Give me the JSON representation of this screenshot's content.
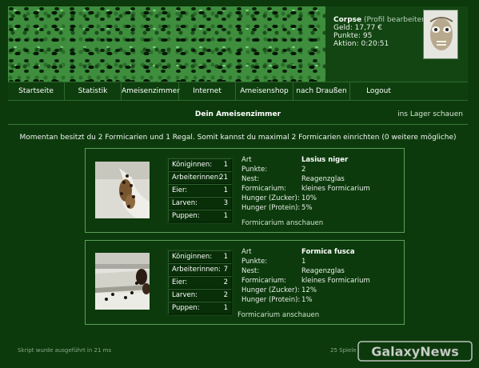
{
  "user": {
    "name": "Corpse",
    "profile_link": "(Profil bearbeiten)",
    "geld": "Geld: 17,77 €",
    "punkte": "Punkte: 95",
    "aktion": "Aktion: 0:20:51"
  },
  "nav": {
    "items": [
      "Startseite",
      "Statistik",
      "Ameisenzimmer",
      "Internet",
      "Ameisenshop",
      "nach Draußen",
      "Logout"
    ]
  },
  "page": {
    "title": "Dein Ameisenzimmer",
    "lager_link": "ins Lager schauen",
    "status": "Momentan besitzt du 2 Formicarien und 1 Regal. Somit kannst du maximal 2 Formicarien einrichten (0 weitere mögliche)"
  },
  "formicarien": [
    {
      "counts": [
        {
          "label": "Königinnen:",
          "value": "1"
        },
        {
          "label": "Arbeiterinnen:",
          "value": "21"
        },
        {
          "label": "Eier:",
          "value": "1"
        },
        {
          "label": "Larven:",
          "value": "3"
        },
        {
          "label": "Puppen:",
          "value": "1"
        }
      ],
      "info": [
        {
          "label": "Art",
          "value": "Lasius niger",
          "bold": true
        },
        {
          "label": "Punkte:",
          "value": "2"
        },
        {
          "label": "Nest:",
          "value": "Reagenzglas"
        },
        {
          "label": "Formicarium:",
          "value": "kleines Formicarium"
        },
        {
          "label": "Hunger (Zucker):",
          "value": "10%"
        },
        {
          "label": "Hunger (Protein):",
          "value": "5%"
        }
      ],
      "link": "Formicarium anschauen"
    },
    {
      "counts": [
        {
          "label": "Königinnen:",
          "value": "1"
        },
        {
          "label": "Arbeiterinnen:",
          "value": "7"
        },
        {
          "label": "Eier:",
          "value": "2"
        },
        {
          "label": "Larven:",
          "value": "2"
        },
        {
          "label": "Puppen:",
          "value": "1"
        }
      ],
      "info": [
        {
          "label": "Art",
          "value": "Formica fusca",
          "bold": true
        },
        {
          "label": "Punkte:",
          "value": "1"
        },
        {
          "label": "Nest:",
          "value": "Reagenzglas"
        },
        {
          "label": "Formicarium:",
          "value": "kleines Formicarium"
        },
        {
          "label": "Hunger (Zucker):",
          "value": "12%"
        },
        {
          "label": "Hunger (Protein):",
          "value": "1%"
        }
      ],
      "link": "Formicarium anschauen"
    }
  ],
  "footer": {
    "left": "Skript wurde ausgeführt in 21 ms",
    "right": "25 Spiele"
  },
  "watermark": "GalaxyNews"
}
